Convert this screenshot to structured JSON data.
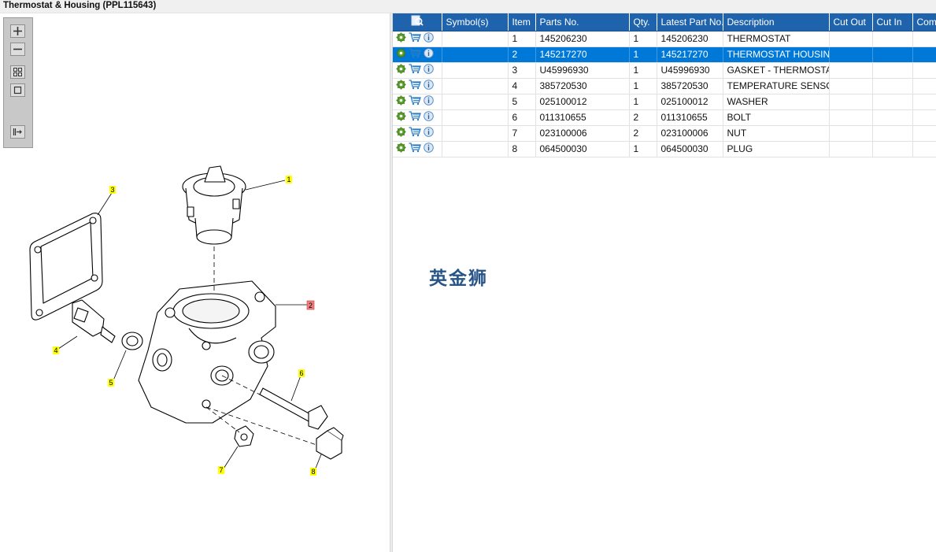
{
  "window": {
    "title": "Thermostat & Housing (PPL115643)"
  },
  "toolbar": {
    "buttons": [
      {
        "name": "zoom-in-button",
        "icon": "plus-icon"
      },
      {
        "name": "zoom-out-button",
        "icon": "minus-icon"
      },
      {
        "name": "fit-view-button",
        "icon": "grid-icon"
      },
      {
        "name": "actual-size-button",
        "icon": "square-icon"
      },
      {
        "name": "export-button",
        "icon": "export-icon"
      }
    ]
  },
  "diagram": {
    "callouts": [
      {
        "label": "1",
        "highlighted": false
      },
      {
        "label": "2",
        "highlighted": true
      },
      {
        "label": "3",
        "highlighted": false
      },
      {
        "label": "4",
        "highlighted": false
      },
      {
        "label": "5",
        "highlighted": false
      },
      {
        "label": "6",
        "highlighted": false
      },
      {
        "label": "7",
        "highlighted": false
      },
      {
        "label": "8",
        "highlighted": false
      }
    ],
    "highlight_color": "#f08080",
    "callout_color": "#ffff00"
  },
  "table": {
    "columns": [
      "Symbol(s)",
      "Item",
      "Parts No.",
      "Qty.",
      "Latest Part No.",
      "Description",
      "Cut Out",
      "Cut In",
      "Comment"
    ],
    "rows": [
      {
        "item": "1",
        "parts_no": "145206230",
        "qty": "1",
        "latest": "145206230",
        "description": "THERMOSTAT",
        "cut_out": "",
        "cut_in": "",
        "comment": "",
        "selected": false
      },
      {
        "item": "2",
        "parts_no": "145217270",
        "qty": "1",
        "latest": "145217270",
        "description": "THERMOSTAT HOUSING",
        "cut_out": "",
        "cut_in": "",
        "comment": "",
        "selected": true
      },
      {
        "item": "3",
        "parts_no": "U45996930",
        "qty": "1",
        "latest": "U45996930",
        "description": "GASKET - THERMOSTAT H",
        "cut_out": "",
        "cut_in": "",
        "comment": "",
        "selected": false
      },
      {
        "item": "4",
        "parts_no": "385720530",
        "qty": "1",
        "latest": "385720530",
        "description": "TEMPERATURE SENSOR",
        "cut_out": "",
        "cut_in": "",
        "comment": "",
        "selected": false
      },
      {
        "item": "5",
        "parts_no": "025100012",
        "qty": "1",
        "latest": "025100012",
        "description": "WASHER",
        "cut_out": "",
        "cut_in": "",
        "comment": "",
        "selected": false
      },
      {
        "item": "6",
        "parts_no": "011310655",
        "qty": "2",
        "latest": "011310655",
        "description": "BOLT",
        "cut_out": "",
        "cut_in": "",
        "comment": "",
        "selected": false
      },
      {
        "item": "7",
        "parts_no": "023100006",
        "qty": "2",
        "latest": "023100006",
        "description": "NUT",
        "cut_out": "",
        "cut_in": "",
        "comment": "",
        "selected": false
      },
      {
        "item": "8",
        "parts_no": "064500030",
        "qty": "1",
        "latest": "064500030",
        "description": "PLUG",
        "cut_out": "",
        "cut_in": "",
        "comment": "",
        "selected": false
      }
    ],
    "row_icons": [
      "gear-icon",
      "cart-icon",
      "info-icon"
    ],
    "header_color": "#1f63ad",
    "selected_color": "#0078d7"
  },
  "watermark": {
    "text": "英金狮"
  }
}
